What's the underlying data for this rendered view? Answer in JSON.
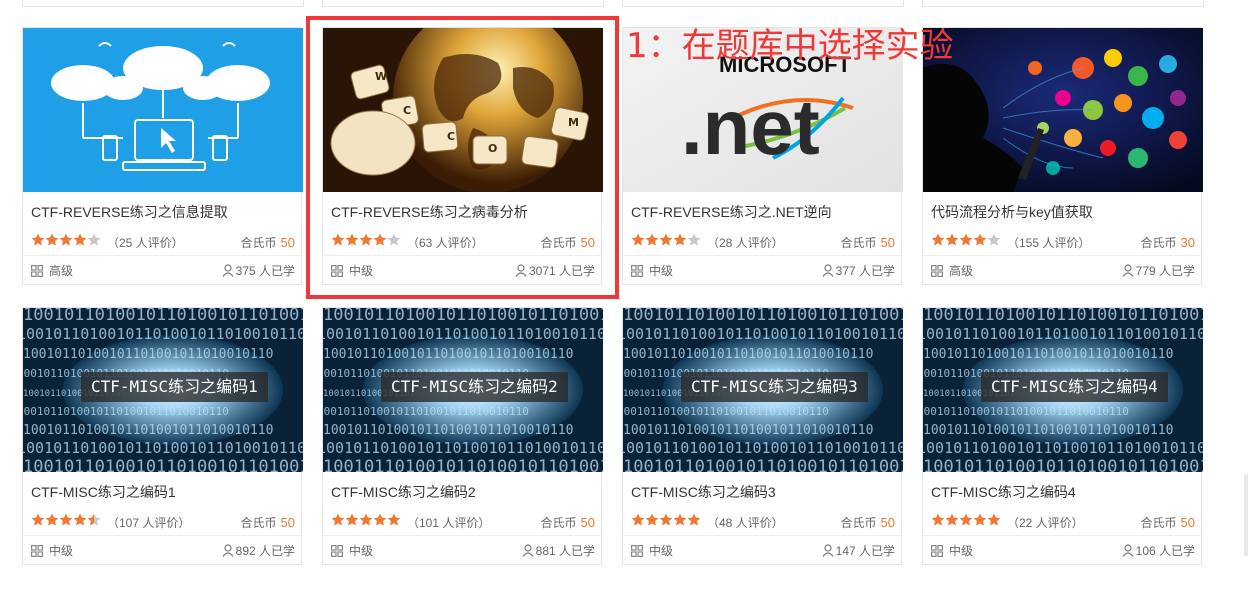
{
  "annotation": {
    "text": "1：在题库中选择实验",
    "color": "#f03838"
  },
  "accent_price_color": "#f07830",
  "cards": [
    {
      "title": "CTF-REVERSE练习之信息提取",
      "rating": 4,
      "reviews": "（25 人评价）",
      "price_label": "合氏币",
      "price": "50",
      "level": "高级",
      "learners": "375 人已学",
      "thumb": "network-illustration"
    },
    {
      "title": "CTF-REVERSE练习之病毒分析",
      "rating": 4,
      "reviews": "（63 人评价）",
      "price_label": "合氏币",
      "price": "50",
      "level": "中级",
      "learners": "3071 人已学",
      "thumb": "keyboard-globe-photo"
    },
    {
      "title": "CTF-REVERSE练习之.NET逆向",
      "rating": 4,
      "reviews": "（28 人评价）",
      "price_label": "合氏币",
      "price": "50",
      "level": "中级",
      "learners": "377 人已学",
      "thumb": "microsoft-dotnet-logo",
      "thumb_text": {
        "line1": "MICROSOFT",
        "line2": ".net"
      }
    },
    {
      "title": "代码流程分析与key值获取",
      "rating": 4,
      "reviews": "（155 人评价）",
      "price_label": "合氏币",
      "price": "30",
      "level": "高级",
      "learners": "779 人已学",
      "thumb": "person-with-app-icons"
    },
    {
      "title": "CTF-MISC练习之编码1",
      "rating": 4.5,
      "reviews": "（107 人评价）",
      "price_label": "合氏币",
      "price": "50",
      "level": "中级",
      "learners": "892 人已学",
      "thumb": "binary-tunnel",
      "thumb_label": "CTF-MISC练习之编码1"
    },
    {
      "title": "CTF-MISC练习之编码2",
      "rating": 5,
      "reviews": "（101 人评价）",
      "price_label": "合氏币",
      "price": "50",
      "level": "中级",
      "learners": "881 人已学",
      "thumb": "binary-tunnel",
      "thumb_label": "CTF-MISC练习之编码2"
    },
    {
      "title": "CTF-MISC练习之编码3",
      "rating": 5,
      "reviews": "（48 人评价）",
      "price_label": "合氏币",
      "price": "50",
      "level": "中级",
      "learners": "147 人已学",
      "thumb": "binary-tunnel",
      "thumb_label": "CTF-MISC练习之编码3"
    },
    {
      "title": "CTF-MISC练习之编码4",
      "rating": 5,
      "reviews": "（22 人评价）",
      "price_label": "合氏币",
      "price": "50",
      "level": "中级",
      "learners": "106 人已学",
      "thumb": "binary-tunnel",
      "thumb_label": "CTF-MISC练习之编码4"
    }
  ]
}
